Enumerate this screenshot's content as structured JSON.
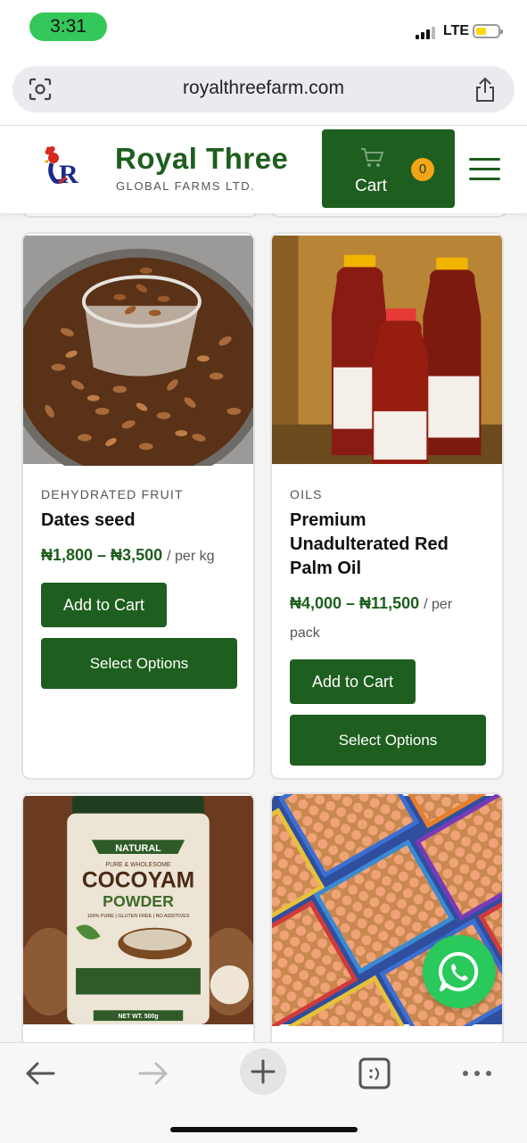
{
  "status_bar": {
    "time": "3:31",
    "network": "LTE"
  },
  "browser": {
    "url": "royalthreefarm.com"
  },
  "header": {
    "brand": "Royal Three",
    "subbrand": "GLOBAL FARMS LTD.",
    "cart_label": "Cart",
    "cart_count": "0"
  },
  "products": [
    {
      "category": "DEHYDRATED FRUIT",
      "name": "Dates seed",
      "price": "₦1,800 – ₦3,500",
      "unit": "/ per kg",
      "add_label": "Add to Cart",
      "options_label": "Select Options"
    },
    {
      "category": "OILS",
      "name": "Premium Unadulterated Red Palm Oil",
      "price": "₦4,000 – ₦11,500",
      "unit": "/ per pack",
      "add_label": "Add to Cart",
      "options_label": "Select Options"
    },
    {
      "image_text": {
        "badge": "NATURAL",
        "tagline": "PURE & WHOLESOME",
        "title1": "COCOYAM",
        "title2": "POWDER",
        "claims": "100% PURE | GLUTEN FREE | NO ADDITIVES",
        "net": "NET WT. 500g"
      }
    },
    {}
  ],
  "colors": {
    "brand_green": "#1e5e1e",
    "badge_orange": "#f2a516",
    "whatsapp_green": "#29c95b"
  },
  "icons": [
    "lens-icon",
    "share-icon",
    "logo-icon",
    "cart-icon",
    "hamburger-menu-icon",
    "whatsapp-icon",
    "back-icon",
    "forward-icon",
    "new-tab-icon",
    "tabs-icon",
    "more-icon"
  ]
}
